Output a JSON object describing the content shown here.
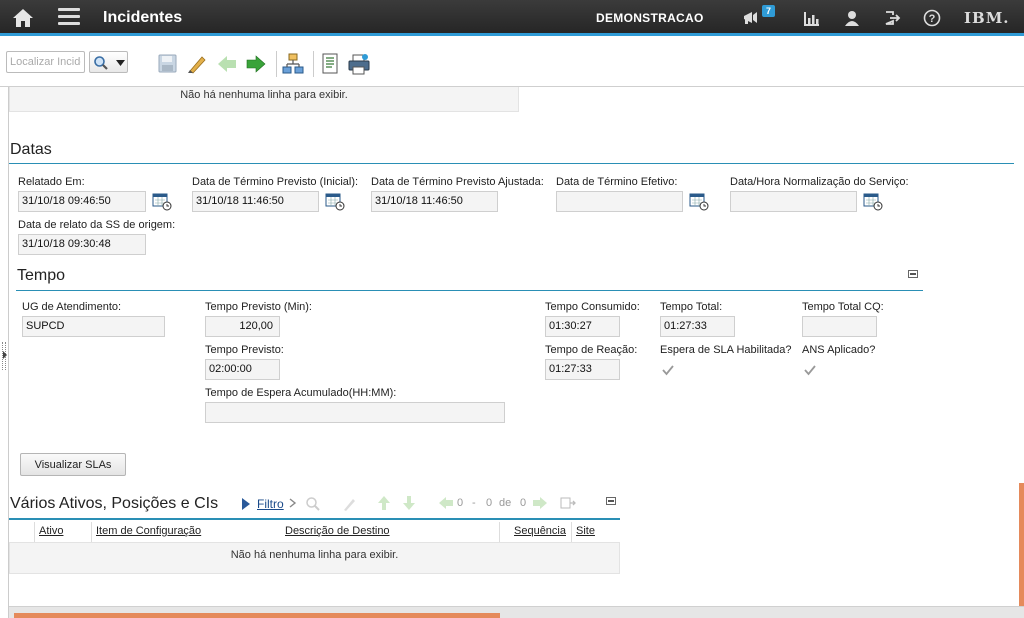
{
  "header": {
    "title": "Incidentes",
    "user": "DEMONSTRACAO",
    "notification_count": "7",
    "brand": "IBM.",
    "icons": [
      "home-icon",
      "menu-icon",
      "megaphone-icon",
      "chart-icon",
      "user-icon",
      "logout-icon",
      "help-icon"
    ]
  },
  "toolbar": {
    "search_placeholder": "Localizar Incide",
    "icons": [
      "save-icon",
      "clear-changes-icon",
      "previous-record-icon",
      "next-record-icon",
      "workflow-icon",
      "report-icon",
      "print-icon"
    ]
  },
  "top_table": {
    "empty_text": "Não há nenhuma linha para exibir."
  },
  "datas": {
    "title": "Datas",
    "fields": [
      {
        "label": "Relatado Em:",
        "value": "31/10/18 09:46:50"
      },
      {
        "label": "Data de Término Previsto (Inicial):",
        "value": "31/10/18 11:46:50"
      },
      {
        "label": "Data de Término Previsto Ajustada:",
        "value": "31/10/18 11:46:50"
      },
      {
        "label": "Data de Término Efetivo:",
        "value": ""
      },
      {
        "label": "Data/Hora Normalização do Serviço:",
        "value": ""
      },
      {
        "label": "Data de relato da SS de origem:",
        "value": "31/10/18 09:30:48"
      }
    ]
  },
  "tempo": {
    "title": "Tempo",
    "ug_label": "UG de Atendimento:",
    "ug_value": "SUPCD",
    "previsto_min_label": "Tempo Previsto (Min):",
    "previsto_min_value": "120,00",
    "previsto_label": "Tempo Previsto:",
    "previsto_value": "02:00:00",
    "espera_label": "Tempo de Espera Acumulado(HH:MM):",
    "espera_value": "",
    "consumido_label": "Tempo Consumido:",
    "consumido_value": "01:30:27",
    "total_label": "Tempo Total:",
    "total_value": "01:27:33",
    "total_cq_label": "Tempo Total CQ:",
    "total_cq_value": "",
    "reacao_label": "Tempo de Reação:",
    "reacao_value": "01:27:33",
    "sla_label": "Espera de SLA Habilitada?",
    "ans_label": "ANS Aplicado?",
    "button_label": "Visualizar SLAs"
  },
  "assets": {
    "title": "Vários Ativos, Posições e CIs",
    "filter_label": "Filtro",
    "pager": {
      "from": "0",
      "dash": "-",
      "to": "0",
      "of": "de",
      "total": "0"
    },
    "columns": [
      "Ativo",
      "Item de Configuração",
      "Descrição de Destino",
      "Sequência",
      "Site"
    ],
    "empty_text": "Não há nenhuma linha para exibir."
  },
  "colors": {
    "header_bg": "#2f2f2f",
    "accent": "#2f9bd6",
    "section_line": "#2a8fb5",
    "progress": "#e58a5b"
  }
}
